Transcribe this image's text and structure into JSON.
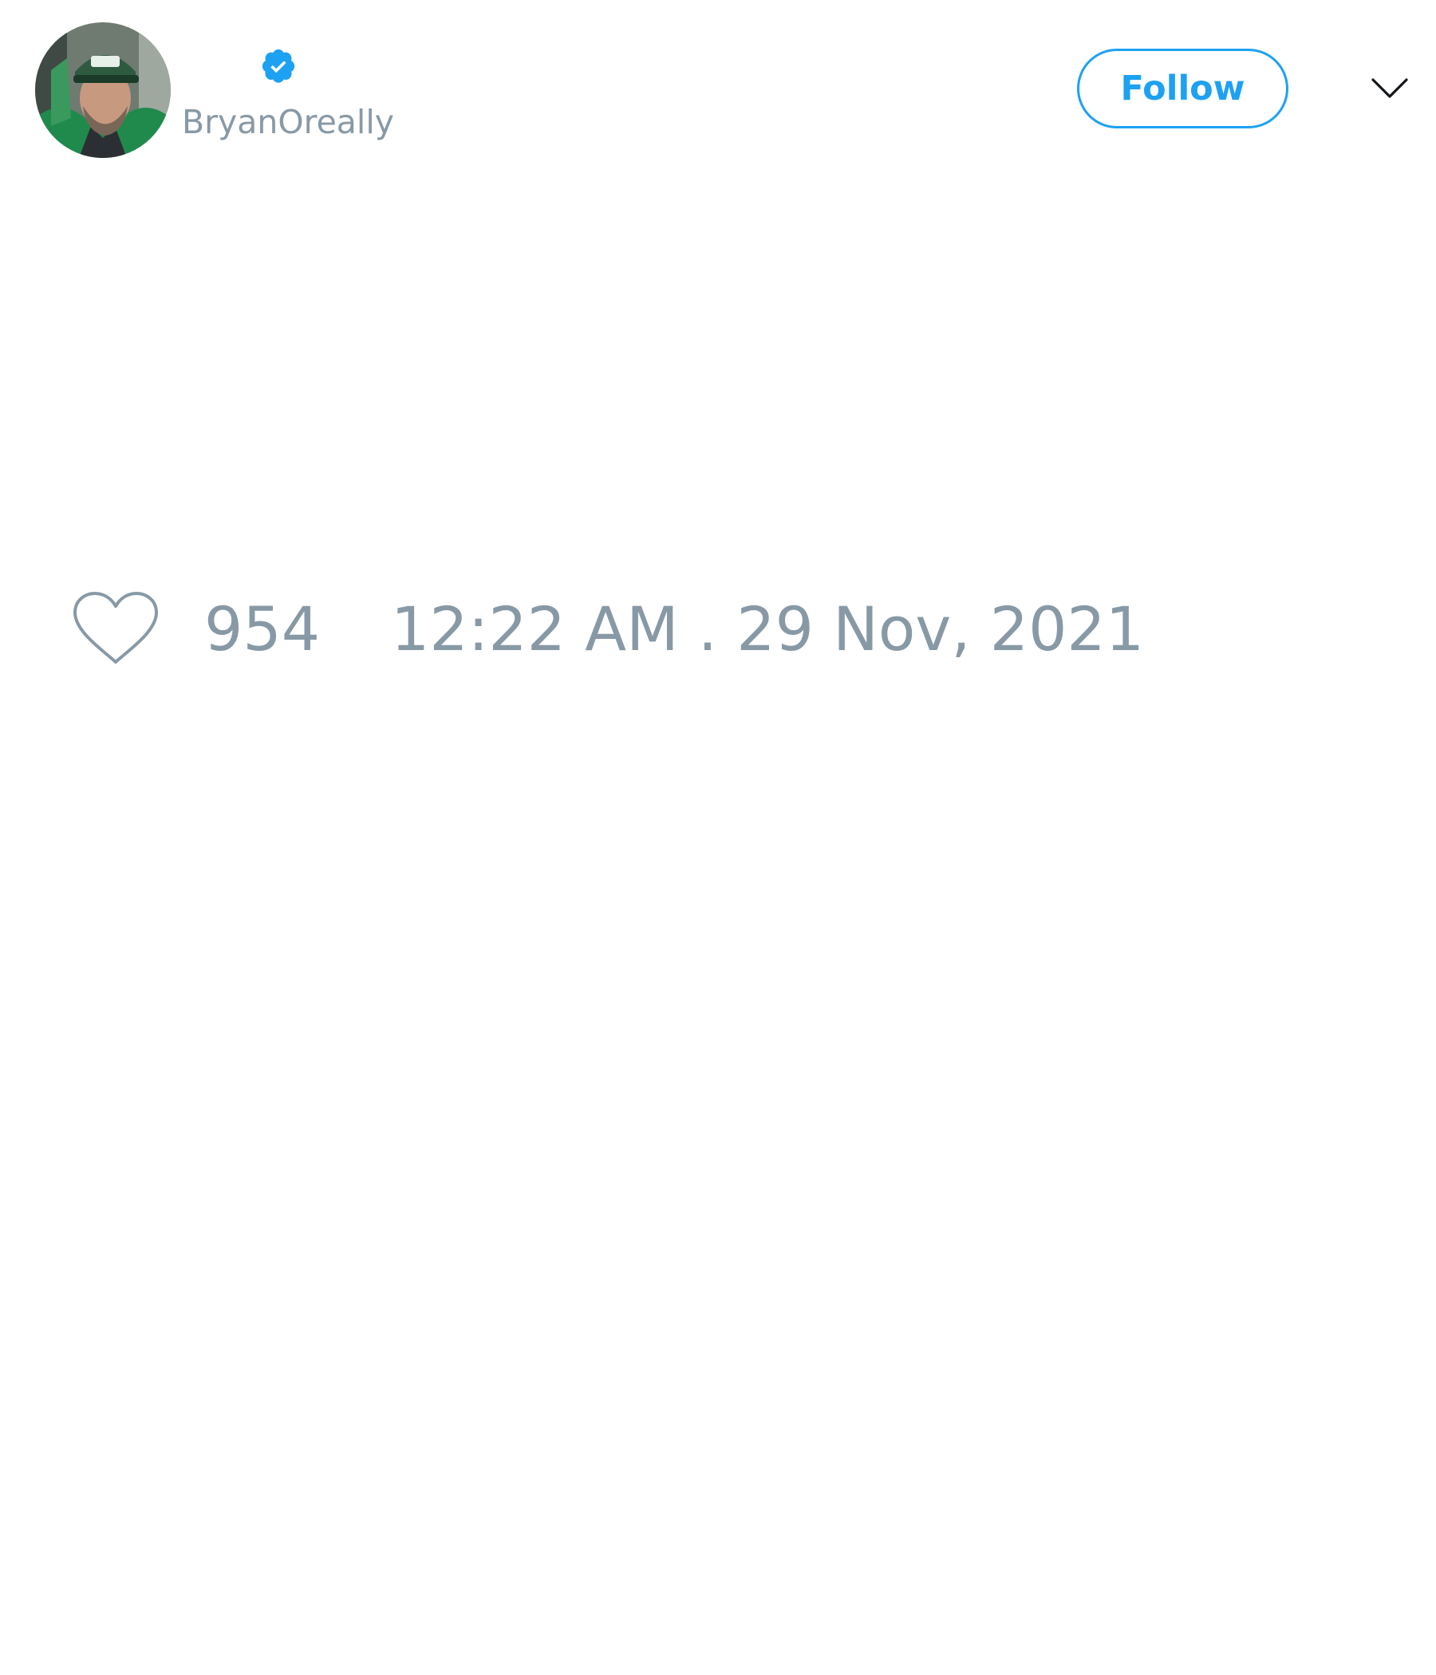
{
  "author": {
    "handle": "BryanOreally",
    "verified": true,
    "avatar_icon": "profile-photo"
  },
  "header": {
    "follow_label": "Follow",
    "menu_icon": "chevron-down-icon"
  },
  "stats": {
    "likes": "954",
    "timestamp": "12:22 AM . 29 Nov, 2021"
  },
  "colors": {
    "accent": "#1da1f2",
    "muted_text": "#8899a6",
    "background": "#ffffff"
  }
}
